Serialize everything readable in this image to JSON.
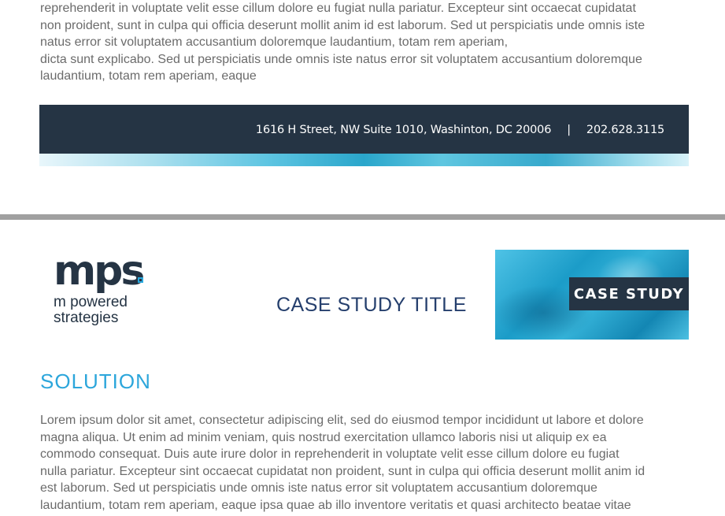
{
  "intro": {
    "lines": [
      "reprehenderit in voluptate velit esse cillum dolore eu fugiat nulla pariatur. Excepteur sint occaecat cupidatat",
      "non proident, sunt in culpa qui officia deserunt mollit anim id est laborum. Sed ut perspiciatis unde omnis iste",
      "natus error sit voluptatem accusantium doloremque laudantium, totam rem aperiam,",
      "dicta sunt explicabo. Sed ut perspiciatis unde omnis iste natus error sit voluptatem accusantium doloremque",
      "laudantium, totam rem aperiam, eaque"
    ]
  },
  "footer": {
    "address": "1616 H Street, NW Suite 1010, Washinton, DC 20006",
    "separator": "|",
    "phone": "202.628.3115"
  },
  "logo": {
    "mark": "mps",
    "tagline_1": "m powered",
    "tagline_2": "strategies"
  },
  "header": {
    "title": "CASE STUDY TITLE",
    "hero_label": "CASE STUDY"
  },
  "solution": {
    "heading": "SOLUTION",
    "lines": [
      "Lorem ipsum dolor sit amet, consectetur adipiscing elit, sed do eiusmod tempor incididunt ut labore et dolore",
      "magna aliqua. Ut enim ad minim veniam, quis nostrud exercitation ullamco laboris nisi ut aliquip ex ea",
      "commodo consequat. Duis aute irure dolor in reprehenderit in voluptate velit esse cillum dolore eu fugiat",
      "nulla pariatur. Excepteur sint occaecat cupidatat non proident, sunt in culpa qui officia deserunt mollit anim id",
      "est laborum. Sed ut perspiciatis unde omnis iste natus error sit voluptatem accusantium doloremque",
      "laudantium, totam rem aperiam, eaque ipsa quae ab illo inventore veritatis et quasi architecto beatae vitae"
    ]
  },
  "colors": {
    "navy": "#253444",
    "accent_blue": "#2ca6db",
    "title_blue": "#253f6d",
    "body_gray": "#6b6b6b",
    "divider_gray": "#a0a0a0"
  }
}
